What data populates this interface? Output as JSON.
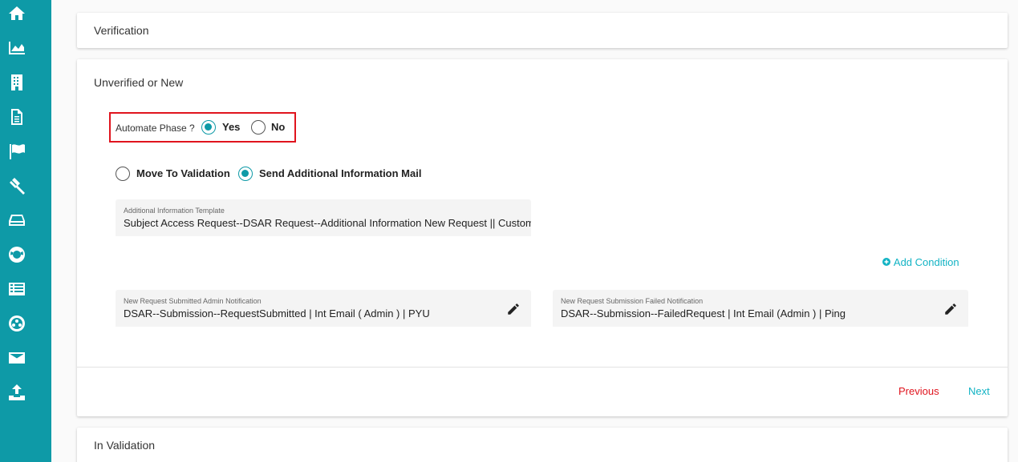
{
  "sidebar": {
    "icons": [
      "home-icon",
      "chart-icon",
      "building-icon",
      "document-icon",
      "flag-icon",
      "gavel-icon",
      "inbox-icon",
      "lifebuoy-icon",
      "list-icon",
      "settings-icon",
      "mail-icon",
      "upload-icon"
    ]
  },
  "sections": {
    "verification_title": "Verification",
    "unverified_title": "Unverified or New",
    "in_validation_title": "In Validation"
  },
  "automate": {
    "label": "Automate Phase ?",
    "yes_label": "Yes",
    "no_label": "No",
    "selected": "Yes"
  },
  "action": {
    "move_label": "Move To Validation",
    "send_label": "Send Additional Information Mail",
    "selected": "Send Additional Information Mail"
  },
  "template_field": {
    "label": "Additional Information Template",
    "value": "Subject Access Request--DSAR Request--Additional Information New Request || Customer"
  },
  "add_condition": {
    "label": "Add Condition"
  },
  "admin_notification": {
    "label": "New Request Submitted Admin Notification",
    "value": "DSAR--Submission--RequestSubmitted | Int Email ( Admin ) | PYU"
  },
  "failed_notification": {
    "label": "New Request Submission Failed Notification",
    "value": "DSAR--Submission--FailedRequest | Int Email (Admin ) | Ping"
  },
  "nav": {
    "previous_label": "Previous",
    "next_label": "Next"
  },
  "colors": {
    "accent": "#0e9aa7",
    "danger": "#e0141e",
    "link": "#12b3c4"
  }
}
